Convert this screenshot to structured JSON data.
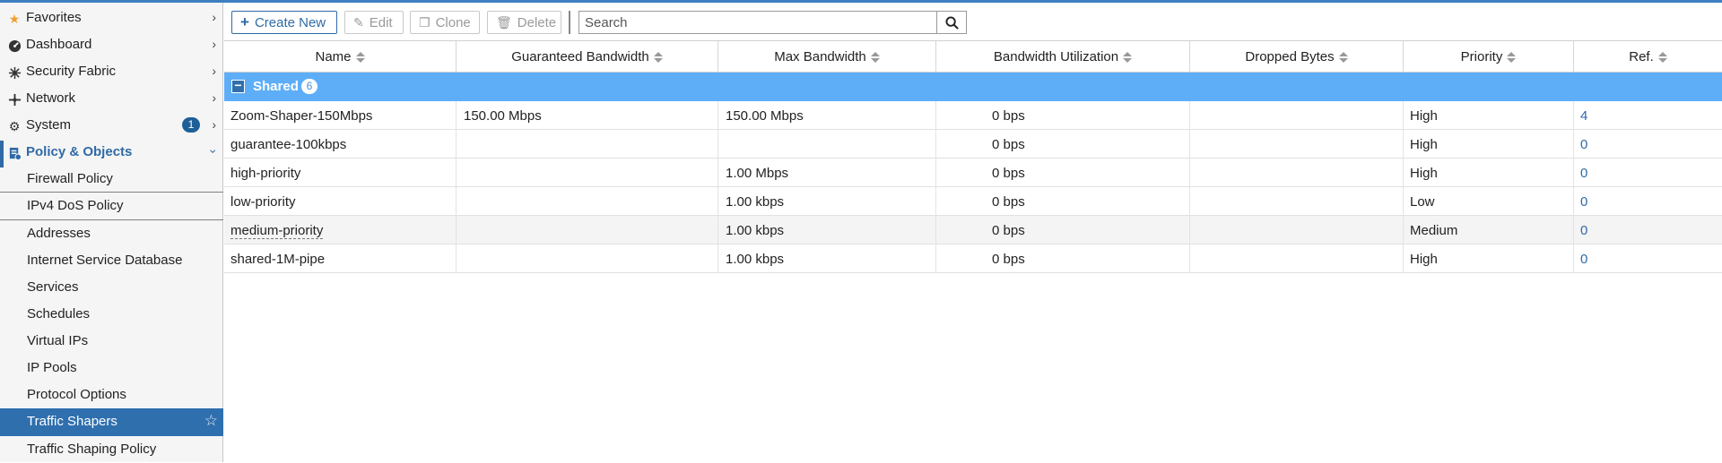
{
  "colors": {
    "accent": "#2f6aa6",
    "selected_bg": "#2f6fae",
    "group_bg": "#5eaef7",
    "badge": "#1f5f99"
  },
  "sidebar": {
    "top": [
      {
        "label": "Favorites",
        "icon": "star-icon"
      },
      {
        "label": "Dashboard",
        "icon": "dashboard-icon"
      },
      {
        "label": "Security Fabric",
        "icon": "fabric-icon"
      },
      {
        "label": "Network",
        "icon": "network-icon"
      },
      {
        "label": "System",
        "icon": "gear-icon",
        "badge": "1"
      },
      {
        "label": "Policy & Objects",
        "icon": "policy-icon"
      }
    ],
    "sub": [
      "Firewall Policy",
      "IPv4 DoS Policy",
      "Addresses",
      "Internet Service Database",
      "Services",
      "Schedules",
      "Virtual IPs",
      "IP Pools",
      "Protocol Options",
      "Traffic Shapers",
      "Traffic Shaping Policy"
    ],
    "selected": "Traffic Shapers"
  },
  "toolbar": {
    "create_new": "Create New",
    "edit": "Edit",
    "clone": "Clone",
    "delete": "Delete",
    "search_placeholder": "Search"
  },
  "table": {
    "columns": [
      "Name",
      "Guaranteed Bandwidth",
      "Max Bandwidth",
      "Bandwidth Utilization",
      "Dropped Bytes",
      "Priority",
      "Ref."
    ],
    "group": {
      "label": "Shared",
      "count": "6"
    },
    "rows": [
      {
        "name": "Zoom-Shaper-150Mbps",
        "guaranteed": "150.00 Mbps",
        "max": "150.00 Mbps",
        "utilization": "0 bps",
        "dropped": "",
        "priority": "High",
        "ref": "4"
      },
      {
        "name": "guarantee-100kbps",
        "guaranteed": "",
        "max": "",
        "utilization": "0 bps",
        "dropped": "",
        "priority": "High",
        "ref": "0"
      },
      {
        "name": "high-priority",
        "guaranteed": "",
        "max": "1.00 Mbps",
        "utilization": "0 bps",
        "dropped": "",
        "priority": "High",
        "ref": "0"
      },
      {
        "name": "low-priority",
        "guaranteed": "",
        "max": "1.00 kbps",
        "utilization": "0 bps",
        "dropped": "",
        "priority": "Low",
        "ref": "0"
      },
      {
        "name": "medium-priority",
        "guaranteed": "",
        "max": "1.00 kbps",
        "utilization": "0 bps",
        "dropped": "",
        "priority": "Medium",
        "ref": "0"
      },
      {
        "name": "shared-1M-pipe",
        "guaranteed": "",
        "max": "1.00 kbps",
        "utilization": "0 bps",
        "dropped": "",
        "priority": "High",
        "ref": "0"
      }
    ]
  }
}
